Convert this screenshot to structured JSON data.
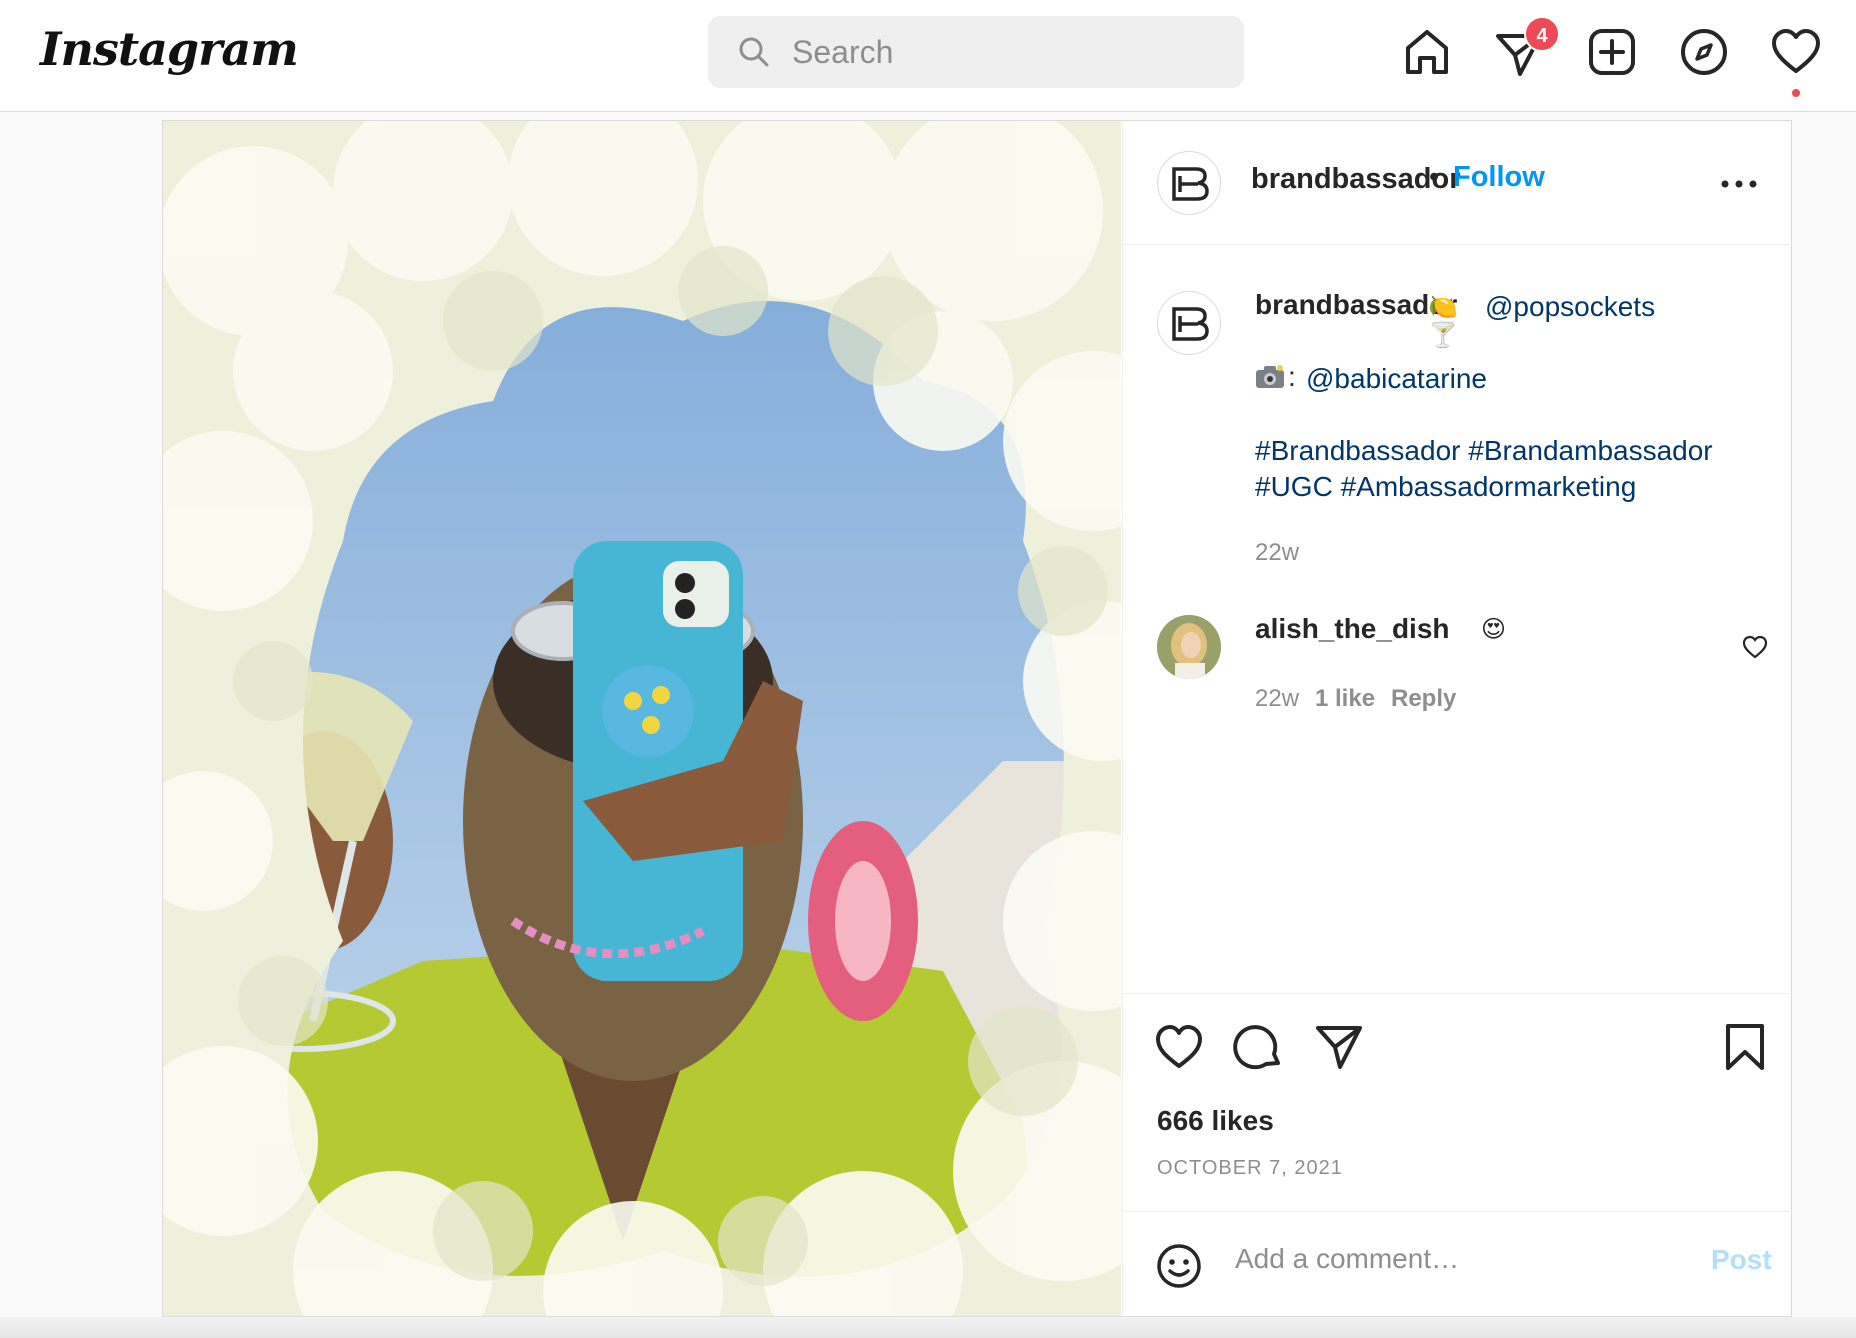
{
  "app": {
    "logo": "Instagram",
    "colors": {
      "accent": "#0095f6",
      "link": "#00376b",
      "badge": "#ed4956",
      "muted": "#8e8e8e"
    }
  },
  "search": {
    "placeholder": "Search",
    "value": ""
  },
  "nav": {
    "icons": [
      "home-icon",
      "direct-messages-icon",
      "new-post-icon",
      "explore-icon",
      "activity-heart-icon"
    ],
    "messages_badge": "4"
  },
  "post": {
    "username": "brandbassador",
    "dot": "•",
    "follow_label": "Follow",
    "caption": {
      "username": "brandbassador",
      "emoji": "🍋🍸",
      "mention_1": "@popsockets",
      "camera_emoji": "📸",
      "colon": ":",
      "mention_2": "@babicatarine",
      "hashtags_line_1": "#Brandbassador #Brandambassador",
      "hashtags_line_2": "#UGC #Ambassadormarketing",
      "time": "22w"
    },
    "comments": [
      {
        "username": "alish_the_dish",
        "emoji": "😍",
        "time": "22w",
        "likes": "1 like",
        "reply_label": "Reply"
      }
    ],
    "likes": "666 likes",
    "date": "OCTOBER 7, 2021",
    "add_comment_placeholder": "Add a comment…",
    "post_label": "Post"
  }
}
